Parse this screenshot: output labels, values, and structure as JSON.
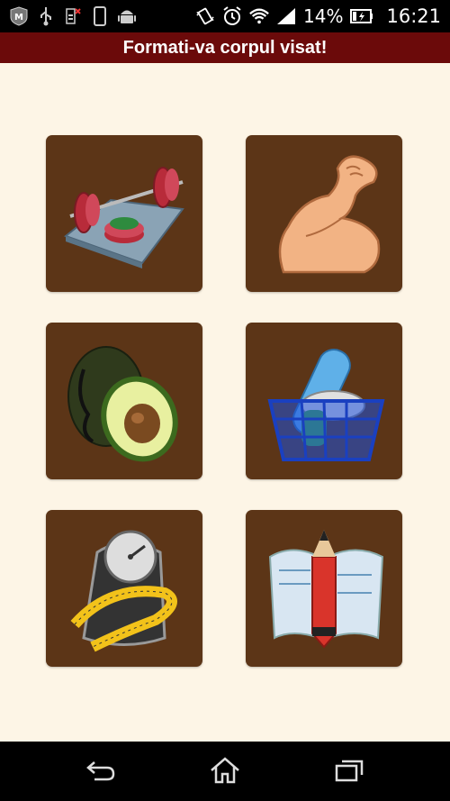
{
  "status_bar": {
    "icons_left": [
      "mcafee-icon",
      "usb-icon",
      "sim-icon",
      "phone-icon",
      "android-icon"
    ],
    "icons_right": [
      "vibrate-icon",
      "alarm-icon",
      "wifi-icon",
      "signal-icon",
      "battery-icon"
    ],
    "battery_percent": "14%",
    "time": "16:21"
  },
  "app": {
    "title": "Formati-va corpul visat!"
  },
  "menu": {
    "tiles": [
      {
        "icon": "barbell-icon"
      },
      {
        "icon": "flexed-arm-icon"
      },
      {
        "icon": "avocado-icon"
      },
      {
        "icon": "supplements-basket-icon"
      },
      {
        "icon": "scale-tape-measure-icon"
      },
      {
        "icon": "pencil-blueprint-icon"
      }
    ]
  },
  "nav_bar": {
    "buttons": [
      "back-icon",
      "home-icon",
      "recent-apps-icon"
    ]
  },
  "colors": {
    "title_bar": "#6b0a0a",
    "background": "#fdf5e6",
    "tile": "#5c3517"
  }
}
